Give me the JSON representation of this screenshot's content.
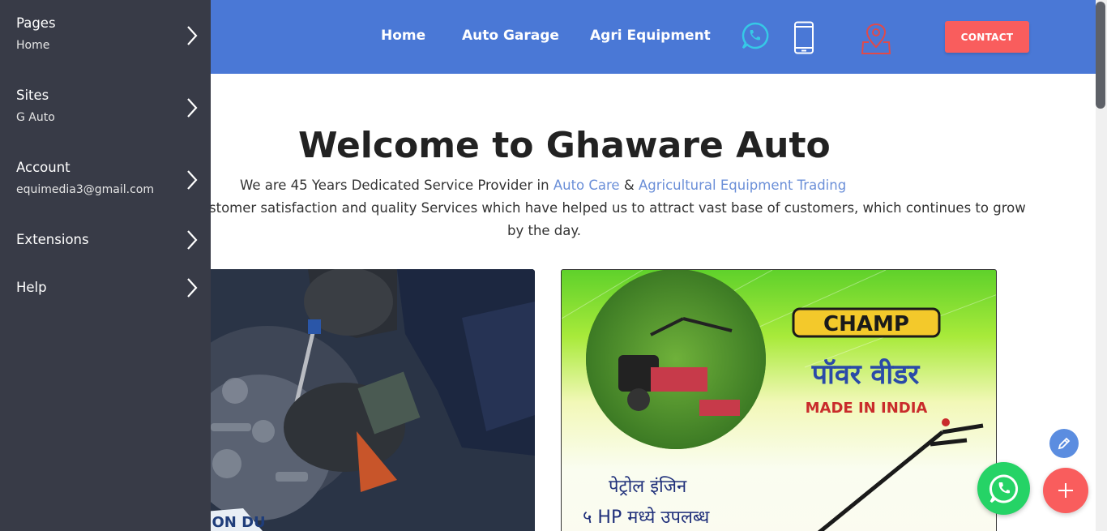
{
  "header": {
    "nav": [
      "Home",
      "Auto Garage",
      "Agri Equipment"
    ],
    "contact_label": "CONTACT",
    "icons": [
      "whatsapp-icon",
      "mobile-phone-icon",
      "location-pin-icon"
    ]
  },
  "main": {
    "title": "Welcome to Ghaware Auto",
    "intro_prefix": "We are 45 Years Dedicated Service Provider in ",
    "link_auto_care": "Auto Care",
    "amp": " & ",
    "link_agri": "Agricultural Equipment Trading",
    "intro_line2": "stomer satisfaction and quality Services which have helped us to attract vast base of customers, which continues to grow",
    "intro_line3": "by the day.",
    "left_image_text": "C ON DU",
    "right_image": {
      "brand": "CHAMP",
      "product": "पॉवर वीडर",
      "made_in": "MADE IN INDIA",
      "line1": "पेट्रोल इंजिन",
      "line2": "५ HP मध्ये उपलब्ध"
    }
  },
  "sidebar": {
    "items": [
      {
        "label": "Pages",
        "sub": "Home"
      },
      {
        "label": "Sites",
        "sub": "G Auto"
      },
      {
        "label": "Account",
        "sub": "equimedia3@gmail.com"
      },
      {
        "label": "Extensions",
        "sub": ""
      },
      {
        "label": "Help",
        "sub": ""
      }
    ]
  },
  "colors": {
    "header": "#4a78d6",
    "sidebar": "#383b47",
    "contact": "#f95d5d",
    "link": "#6b8fd8",
    "whatsapp": "#25d366",
    "fab_add": "#f95d5d",
    "fab_edit": "#5b8de0"
  }
}
